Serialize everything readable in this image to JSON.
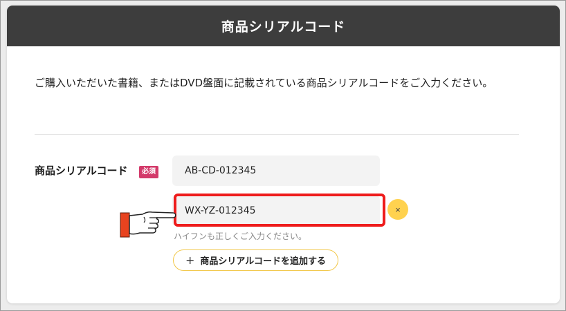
{
  "header": {
    "title": "商品シリアルコード"
  },
  "description": "ご購入いただいた書籍、またはDVD盤面に記載されている商品シリアルコードをご入力ください。",
  "form": {
    "label": "商品シリアルコード",
    "required_badge": "必須",
    "inputs": [
      {
        "value": "AB-CD-012345"
      },
      {
        "value": "WX-YZ-012345"
      }
    ],
    "clear_button": "×",
    "hint": "ハイフンも正しくご入力ください。",
    "add_button": {
      "icon": "+",
      "label": "商品シリアルコードを追加する"
    }
  },
  "colors": {
    "header_bg": "#3d3d3d",
    "badge": "#d33a6a",
    "highlight": "#ee1c1c",
    "accent": "#ffd24f"
  },
  "icons": {
    "pointer": "pointing-hand-icon",
    "clear": "close-icon",
    "add": "plus-icon"
  }
}
